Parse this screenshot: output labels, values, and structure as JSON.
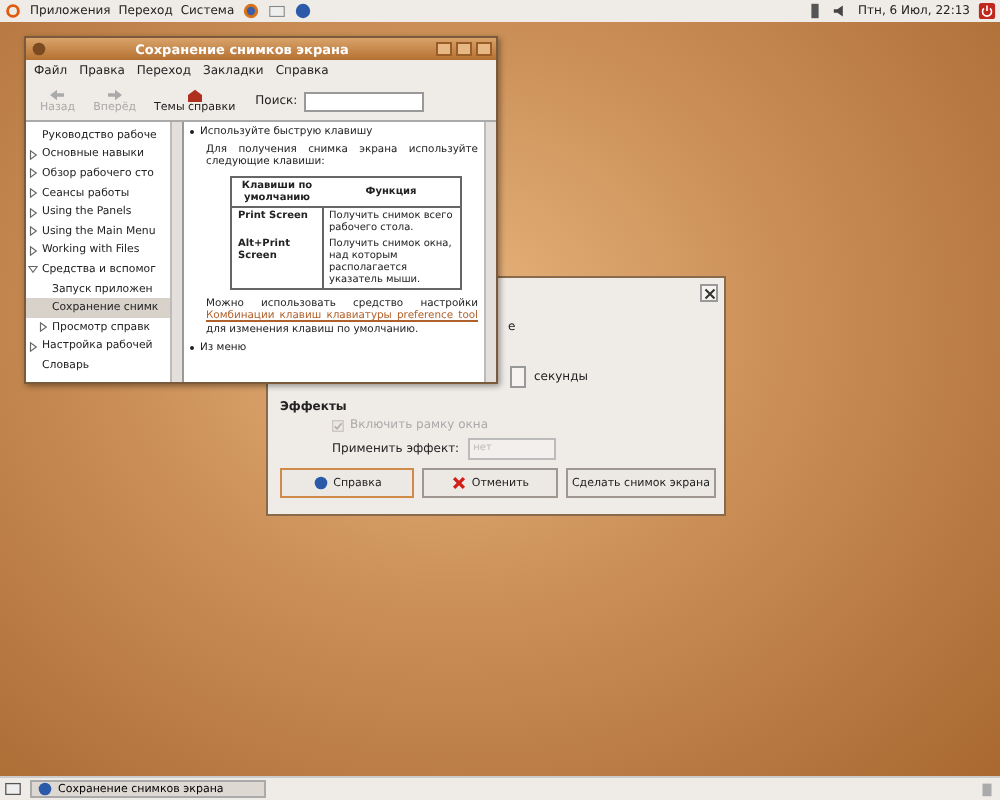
{
  "top_panel": {
    "menus": [
      "Приложения",
      "Переход",
      "Система"
    ],
    "clock": "Птн, 6 Июл, 22:13"
  },
  "help_window": {
    "title": "Сохранение снимков экрана",
    "menu": [
      "Файл",
      "Правка",
      "Переход",
      "Закладки",
      "Справка"
    ],
    "toolbar": [
      {
        "label": "Назад",
        "kind": "back",
        "disabled": true
      },
      {
        "label": "Вперёд",
        "kind": "forward",
        "disabled": true
      },
      {
        "label": "Темы справки",
        "kind": "topics",
        "disabled": false
      }
    ],
    "search": {
      "label": "Поиск:"
    },
    "sidebar": [
      {
        "label": "Руководство рабоче",
        "kind": "leaf",
        "selected": false
      },
      {
        "label": "Основные навыки",
        "kind": "folder",
        "expanded": false,
        "selected": false
      },
      {
        "label": "Обзор рабочего сто",
        "kind": "folder",
        "expanded": false,
        "selected": false
      },
      {
        "label": "Сеансы работы",
        "kind": "folder",
        "expanded": false,
        "selected": false
      },
      {
        "label": "Using the Panels",
        "kind": "folder",
        "expanded": false,
        "selected": false
      },
      {
        "label": "Using the Main Menu",
        "kind": "folder",
        "expanded": false,
        "selected": false
      },
      {
        "label": "Working with Files",
        "kind": "folder",
        "expanded": false,
        "selected": false
      },
      {
        "label": "Средства и вспомог",
        "kind": "folder",
        "expanded": true,
        "selected": false,
        "children": [
          {
            "label": "Запуск приложен",
            "kind": "leaf",
            "selected": false
          },
          {
            "label": "Сохранение снимк",
            "kind": "leaf",
            "selected": true
          },
          {
            "label": "Просмотр справк",
            "kind": "folder",
            "expanded": false,
            "selected": false
          }
        ]
      },
      {
        "label": "Настройка рабочей",
        "kind": "folder",
        "expanded": false,
        "selected": false
      },
      {
        "label": "Словарь",
        "kind": "leaf",
        "selected": false
      }
    ],
    "content": {
      "bullet_1": "Используйте быструю клавишу",
      "intro": "Для получения снимка экрана используйте следующие клавиши:",
      "table": {
        "columns": [
          "Клавиши по умолчанию",
          "Функция"
        ],
        "rows": [
          [
            "Print Screen",
            "Получить снимок всего рабочего стола."
          ],
          [
            "Alt+Print Screen",
            "Получить снимок окна, над которым располагается указатель мыши."
          ]
        ]
      },
      "para_before": "Можно использовать средство настройки",
      "link": "Комбинации клавиш клавиатуры preference tool",
      "para_after": "для изменения клавиш по умолчанию.",
      "bullet_2": "Из меню"
    }
  },
  "dialog": {
    "fragment": "е",
    "delay_unit": "секунды",
    "effects_heading": "Эффекты",
    "border_checkbox": {
      "label": "Включить рамку окна",
      "checked": true,
      "disabled": true
    },
    "effect": {
      "label": "Применить эффект:",
      "value": "нет",
      "disabled": true
    },
    "buttons": [
      {
        "label": "Справка",
        "kind": "help",
        "default": true
      },
      {
        "label": "Отменить",
        "kind": "cancel",
        "default": false
      },
      {
        "label": "Сделать снимок экрана",
        "kind": "plain",
        "default": false
      }
    ]
  },
  "taskbar": {
    "tasks": [
      "Сохранение снимков экрана"
    ]
  }
}
